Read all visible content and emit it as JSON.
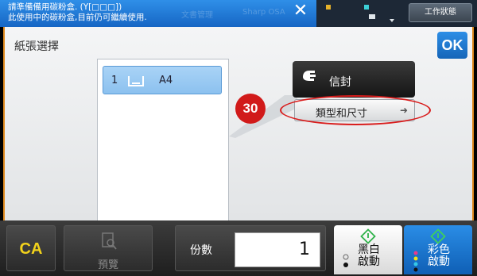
{
  "notification": {
    "line1": "請準備備用碳粉盒. (Y[□□□])",
    "line2": "此使用中的碳粉盒,目前仍可繼續使用.",
    "background_tabs": [
      "文書管理",
      "Sharp OSA"
    ],
    "close_icon": "close-icon"
  },
  "status_tab": {
    "label": "工作狀態"
  },
  "panel": {
    "title": "紙張選擇",
    "ok_label": "OK"
  },
  "tray": {
    "number": "1",
    "icon": "paper-tray-icon",
    "size": "A4"
  },
  "envelope_button": {
    "label": "信封",
    "icon": "hand-feed-icon"
  },
  "type_size_button": {
    "label": "類型和尺寸",
    "icon": "arrow-right-icon"
  },
  "annotation": {
    "step": "30",
    "color": "#d11a1a"
  },
  "bottom": {
    "ca_label": "CA",
    "preview_label": "預覽",
    "copies_label": "份數",
    "copies_value": "1",
    "bw_start_label_1": "黑白",
    "bw_start_label_2": "啟動",
    "color_start_label_1": "彩色",
    "color_start_label_2": "啟動"
  },
  "colors": {
    "accent_blue": "#1d7bd8",
    "frame_orange": "#e08a1e",
    "ca_yellow": "#f2d21b",
    "start_green": "#2fb24a"
  }
}
